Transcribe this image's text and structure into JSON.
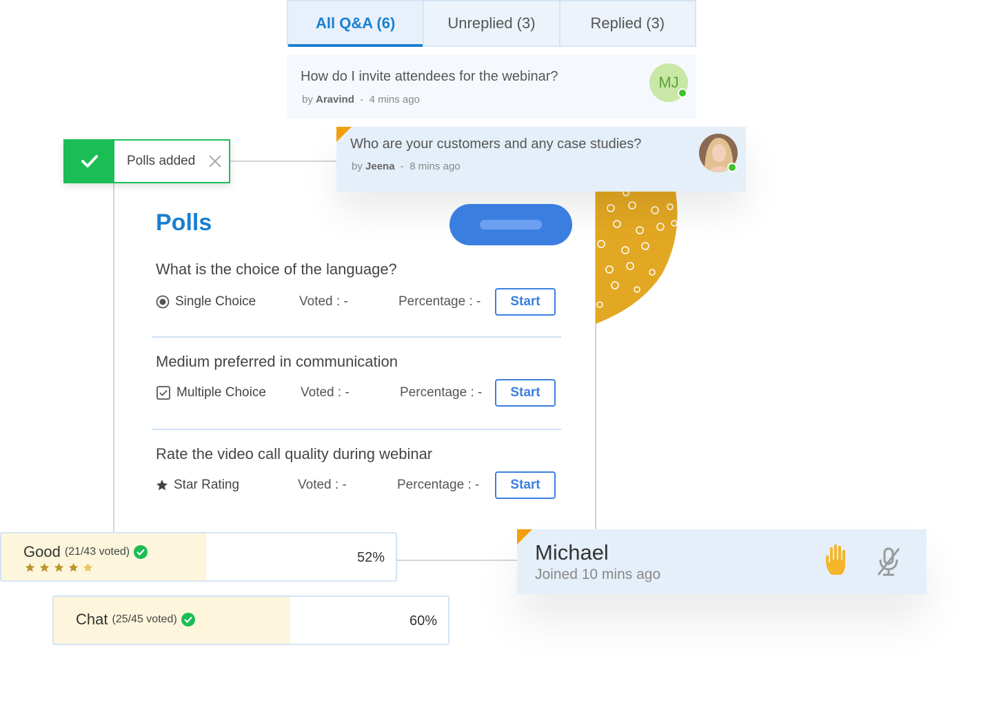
{
  "tabs": [
    {
      "label": "All Q&A (6)",
      "active": true
    },
    {
      "label": "Unreplied (3)",
      "active": false
    },
    {
      "label": "Replied (3)",
      "active": false
    }
  ],
  "questions": [
    {
      "text": "How do I invite attendees for the webinar?",
      "by_prefix": "by",
      "author": "Aravind",
      "separator": "-",
      "time": "4 mins ago",
      "avatar_initials": "MJ",
      "online": true
    },
    {
      "text": "Who are your customers and any case studies?",
      "by_prefix": "by",
      "author": "Jeena",
      "separator": "-",
      "time": "8 mins ago",
      "avatar": "photo",
      "online": true
    }
  ],
  "toast": {
    "text": "Polls added"
  },
  "polls": {
    "title": "Polls",
    "items": [
      {
        "question": "What is the choice of the language?",
        "type": "Single Choice",
        "type_icon": "radio-icon",
        "voted": "Voted : -",
        "percentage": "Percentage : -",
        "start": "Start"
      },
      {
        "question": "Medium preferred in communication",
        "type": "Multiple Choice",
        "type_icon": "checkbox-icon",
        "voted": "Voted : -",
        "percentage": "Percentage : -",
        "start": "Start"
      },
      {
        "question": "Rate the video call quality during webinar",
        "type": "Star Rating",
        "type_icon": "star-icon",
        "voted": "Voted : -",
        "percentage": "Percentage : -",
        "start": "Start"
      }
    ]
  },
  "results": [
    {
      "label": "Good",
      "votes": "(21/43 voted)",
      "percent": "52%",
      "fill": 0.52,
      "stars": 5
    },
    {
      "label": "Chat",
      "votes": "(25/45 voted)",
      "percent": "60%",
      "fill": 0.6
    }
  ],
  "participant": {
    "name": "Michael",
    "joined": "Joined 10 mins ago"
  },
  "colors": {
    "accent": "#1a7fd0",
    "button": "#3a7fe0",
    "success": "#1bbd55",
    "highlight": "#f59e0b",
    "blob": "#e3a823"
  }
}
